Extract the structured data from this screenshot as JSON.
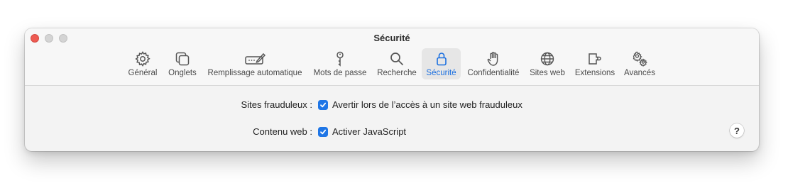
{
  "window": {
    "title": "Sécurité"
  },
  "toolbar": {
    "tabs": [
      {
        "label": "Général",
        "icon": "gear-icon"
      },
      {
        "label": "Onglets",
        "icon": "tabs-icon"
      },
      {
        "label": "Remplissage automatique",
        "icon": "autofill-icon"
      },
      {
        "label": "Mots de passe",
        "icon": "key-icon"
      },
      {
        "label": "Recherche",
        "icon": "magnifier-icon"
      },
      {
        "label": "Sécurité",
        "icon": "lock-icon",
        "selected": true
      },
      {
        "label": "Confidentialité",
        "icon": "hand-icon"
      },
      {
        "label": "Sites web",
        "icon": "globe-icon"
      },
      {
        "label": "Extensions",
        "icon": "puzzle-icon"
      },
      {
        "label": "Avancés",
        "icon": "gears-icon"
      }
    ]
  },
  "settings": {
    "fraud": {
      "label": "Sites frauduleux :",
      "option": "Avertir lors de l’accès à un site web frauduleux",
      "checked": true
    },
    "web_content": {
      "label": "Contenu web :",
      "option": "Activer JavaScript",
      "checked": true
    }
  },
  "help": {
    "label": "?"
  },
  "colors": {
    "accent": "#1f76e6",
    "close": "#ee5b52"
  }
}
